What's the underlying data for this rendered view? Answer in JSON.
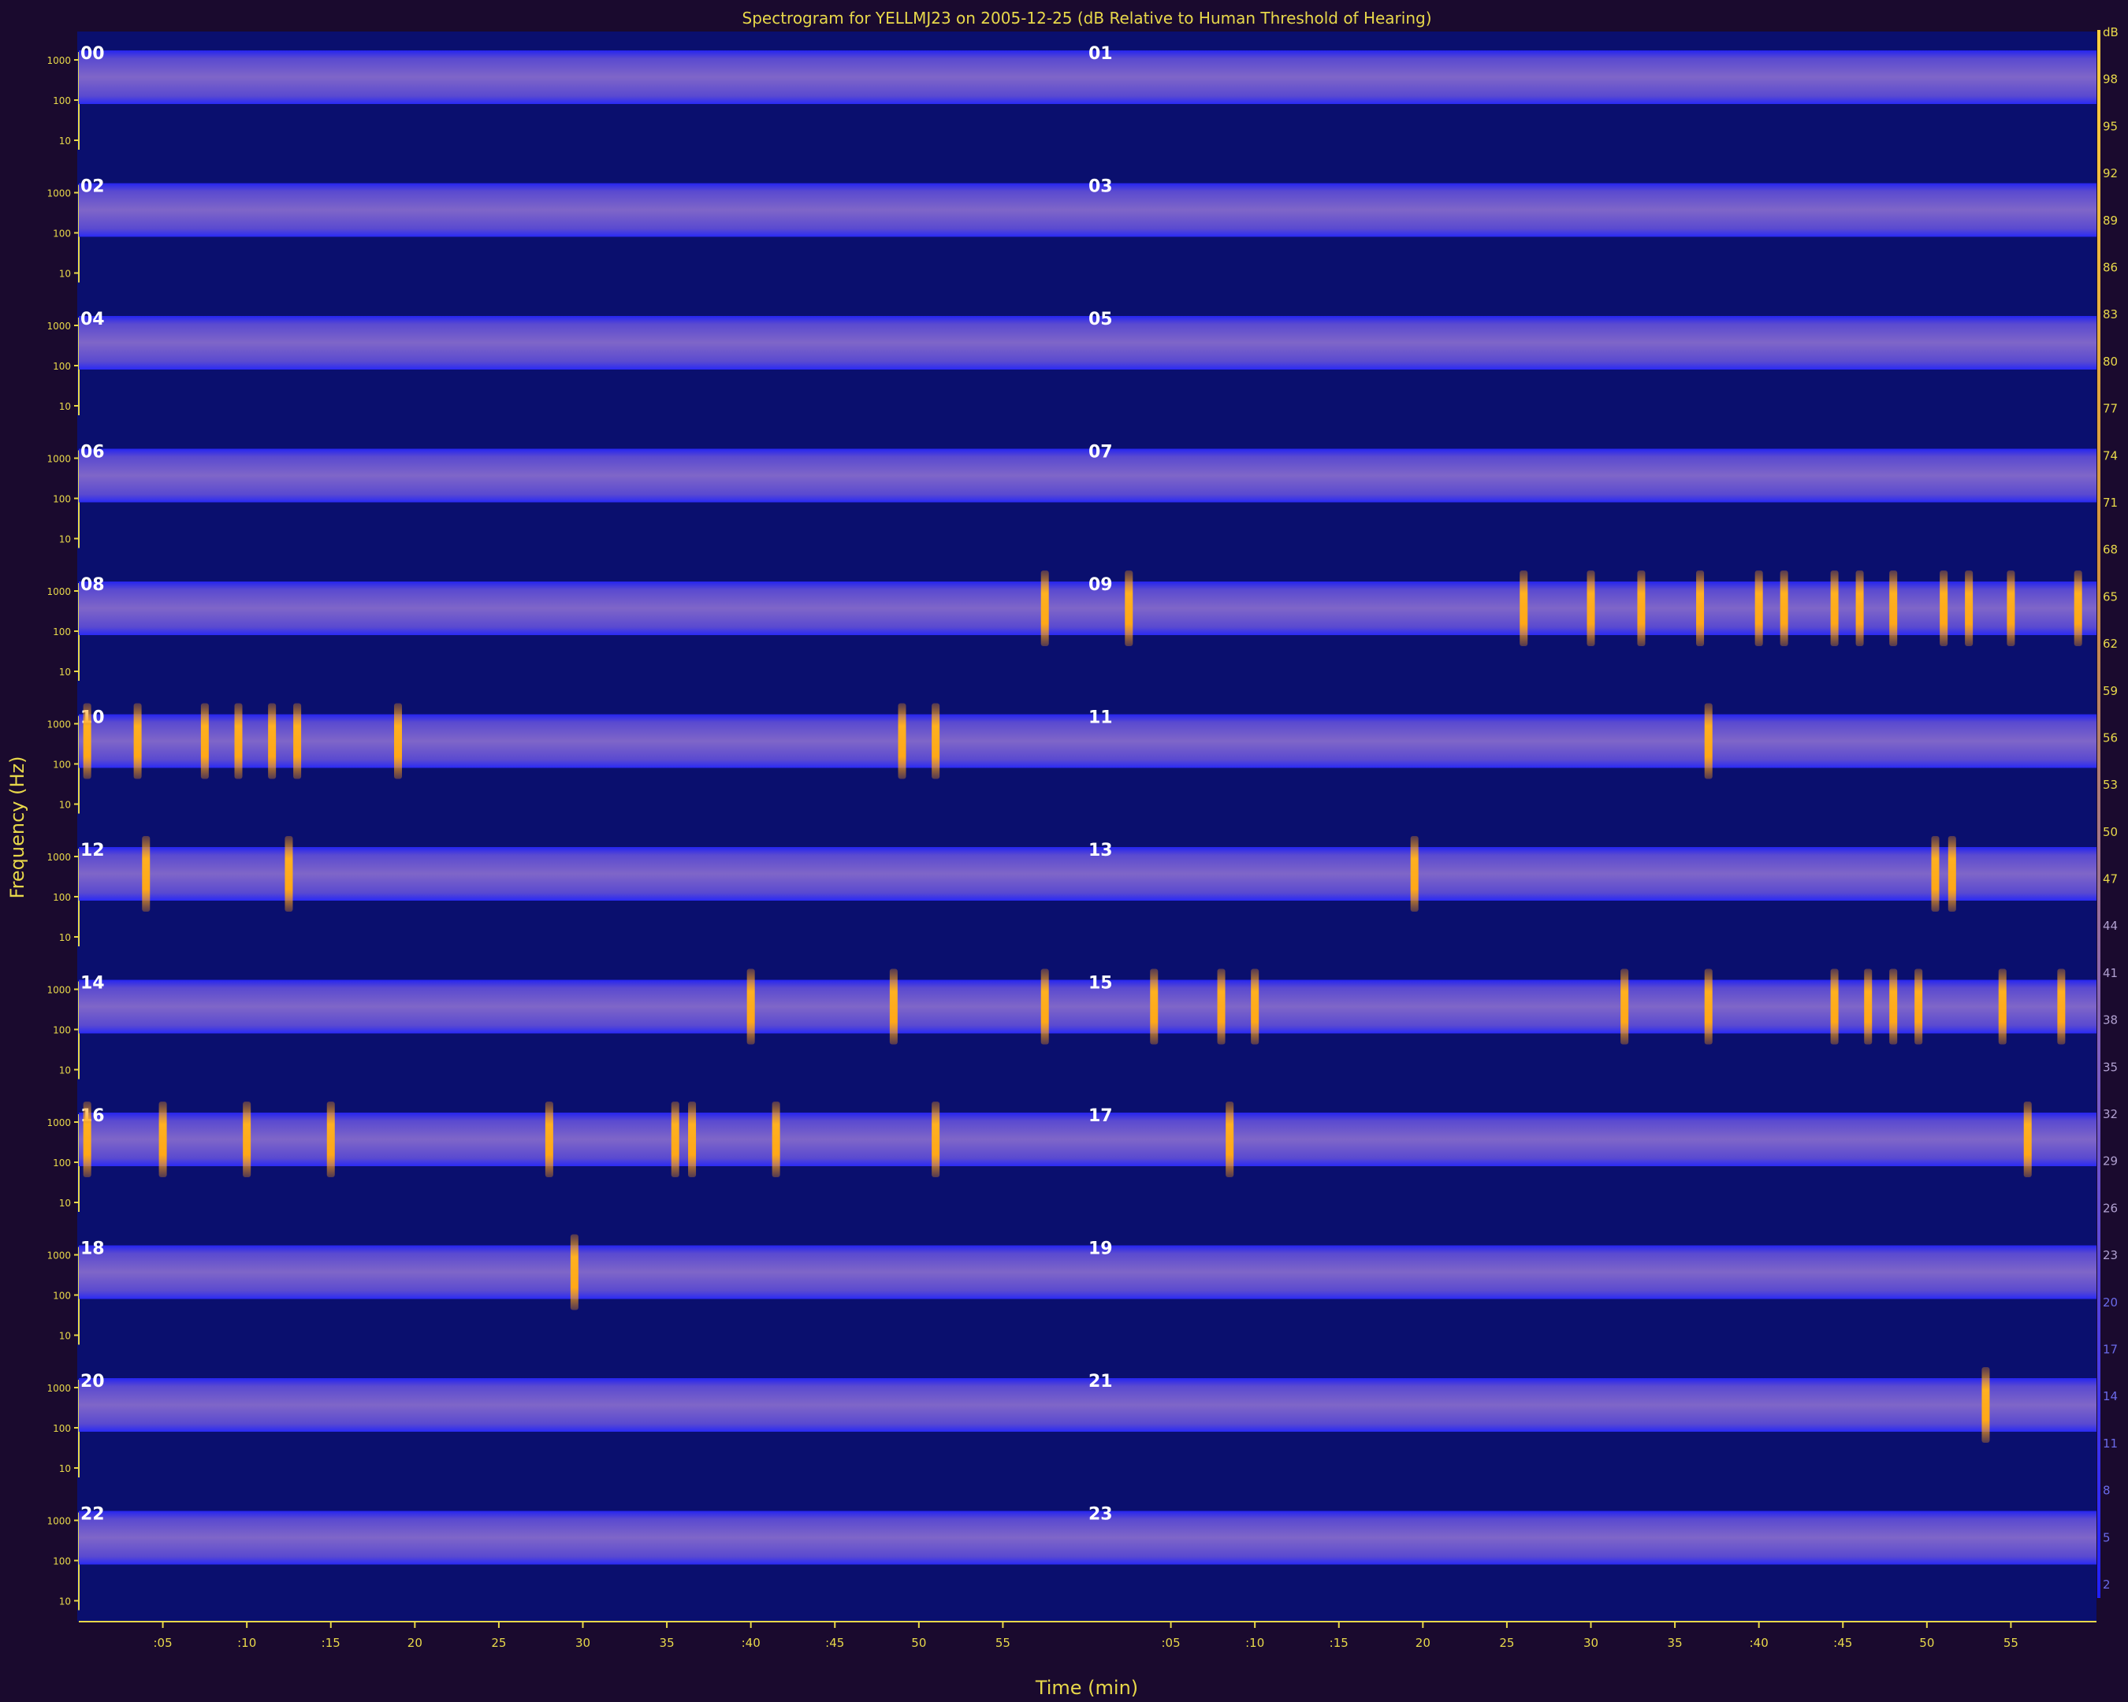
{
  "chart_data": {
    "type": "heatmap",
    "title": "Spectrogram for YELLMJ23 on 2005-12-25 (dB Relative to Human Threshold of Hearing)",
    "xlabel": "Time (min)",
    "ylabel": "Frequency (Hz)",
    "colorbar_unit": "dB",
    "colorbar_range": [
      0,
      100
    ],
    "colorbar_ticks": [
      "dB",
      "98",
      "95",
      "92",
      "89",
      "86",
      "83",
      "80",
      "77",
      "74",
      "71",
      "68",
      "65",
      "62",
      "59",
      "56",
      "53",
      "50",
      "47",
      "44",
      "41",
      "38",
      "35",
      "32",
      "29",
      "26",
      "23",
      "20",
      "17",
      "14",
      "11",
      "8",
      "5",
      "2"
    ],
    "freq_tick_labels": [
      "1000",
      "100",
      "10"
    ],
    "time_tick_labels": [
      ":05",
      ":10",
      ":15",
      "20",
      "25",
      "30",
      "35",
      ":40",
      ":45",
      "50",
      "55"
    ],
    "hours": [
      "00",
      "01",
      "02",
      "03",
      "04",
      "05",
      "06",
      "07",
      "08",
      "09",
      "10",
      "11",
      "12",
      "13",
      "14",
      "15",
      "16",
      "17",
      "18",
      "19",
      "20",
      "21",
      "22",
      "23"
    ],
    "events": {
      "08": [
        57.5
      ],
      "09": [
        2.5,
        26,
        30,
        33,
        36.5,
        40,
        41.5,
        44.5,
        46,
        48,
        51,
        52.5,
        55,
        59
      ],
      "10": [
        0.5,
        3.5,
        7.5,
        9.5,
        11.5,
        13,
        19,
        49,
        51
      ],
      "11": [
        37
      ],
      "12": [
        4,
        12.5
      ],
      "13": [
        19.5,
        50.5,
        51.5
      ],
      "14": [
        40,
        48.5,
        57.5
      ],
      "15": [
        4,
        8,
        10,
        32,
        37,
        44.5,
        46.5,
        48,
        49.5,
        54.5,
        58
      ],
      "16": [
        0.5,
        5,
        10,
        15,
        28,
        35.5,
        36.5,
        41.5,
        51
      ],
      "17": [
        8.5,
        56
      ],
      "18": [
        29.5
      ],
      "21": [
        53.5
      ]
    },
    "colors": {
      "background": "#1a0a2e",
      "plot_bg": "#0a0f6e",
      "band": "#3a35c9",
      "band_edge": "#2222ff",
      "hot": "#ffb020",
      "text": "#e8d84a"
    }
  }
}
